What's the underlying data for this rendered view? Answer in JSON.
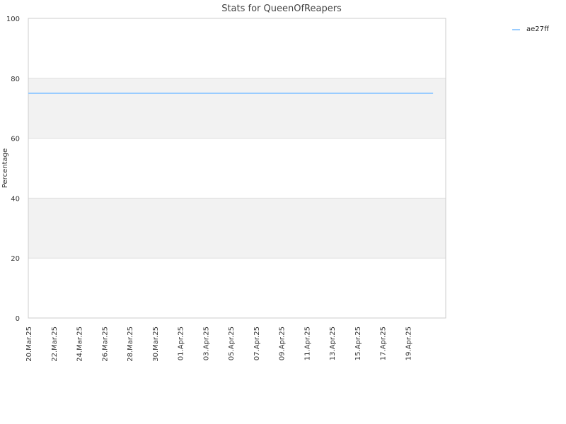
{
  "chart_data": {
    "type": "line",
    "title": "Stats for QueenOfReapers",
    "xlabel": "",
    "ylabel": "Percentage",
    "ylim": [
      0,
      100
    ],
    "yticks": [
      0,
      20,
      40,
      60,
      80,
      100
    ],
    "x_tick_labels": [
      "20.Mar.25",
      "22.Mar.25",
      "24.Mar.25",
      "26.Mar.25",
      "28.Mar.25",
      "30.Mar.25",
      "01.Apr.25",
      "03.Apr.25",
      "05.Apr.25",
      "07.Apr.25",
      "09.Apr.25",
      "11.Apr.25",
      "13.Apr.25",
      "15.Apr.25",
      "17.Apr.25",
      "19.Apr.25"
    ],
    "xlim": [
      "2025-03-20",
      "2025-04-22"
    ],
    "grid": "horizontal alternating bands",
    "legend_position": "top-right",
    "series": [
      {
        "name": "ae27ff",
        "color": "#99ccff",
        "points": [
          {
            "x": "2025-03-20",
            "y": 75
          },
          {
            "x": "2025-04-21",
            "y": 75
          }
        ]
      }
    ]
  },
  "colors": {
    "band": "#f2f2f2",
    "grid": "#dddddd",
    "axis": "#cccccc"
  }
}
